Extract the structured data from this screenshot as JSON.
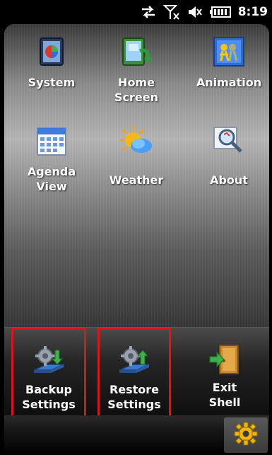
{
  "status_bar": {
    "time": "8:19",
    "icons": [
      "data-sync-icon",
      "no-signal-icon",
      "volume-off-icon",
      "battery-icon"
    ]
  },
  "grid": [
    {
      "label": "System",
      "icon": "system-icon"
    },
    {
      "label": "Home\nScreen",
      "icon": "home-screen-icon"
    },
    {
      "label": "Animation",
      "icon": "animation-icon"
    },
    {
      "label": "Agenda\nView",
      "icon": "calendar-icon"
    },
    {
      "label": "Weather",
      "icon": "weather-icon"
    },
    {
      "label": "About",
      "icon": "about-magnifier-icon"
    }
  ],
  "dock": [
    {
      "label": "Backup\nSettings",
      "icon": "backup-settings-icon",
      "highlighted": true
    },
    {
      "label": "Restore\nSettings",
      "icon": "restore-settings-icon",
      "highlighted": true
    },
    {
      "label": "Exit\nShell",
      "icon": "exit-door-icon",
      "highlighted": false
    }
  ],
  "colors": {
    "highlight_border": "#e0121c",
    "settings_gear": "#f2b705"
  }
}
